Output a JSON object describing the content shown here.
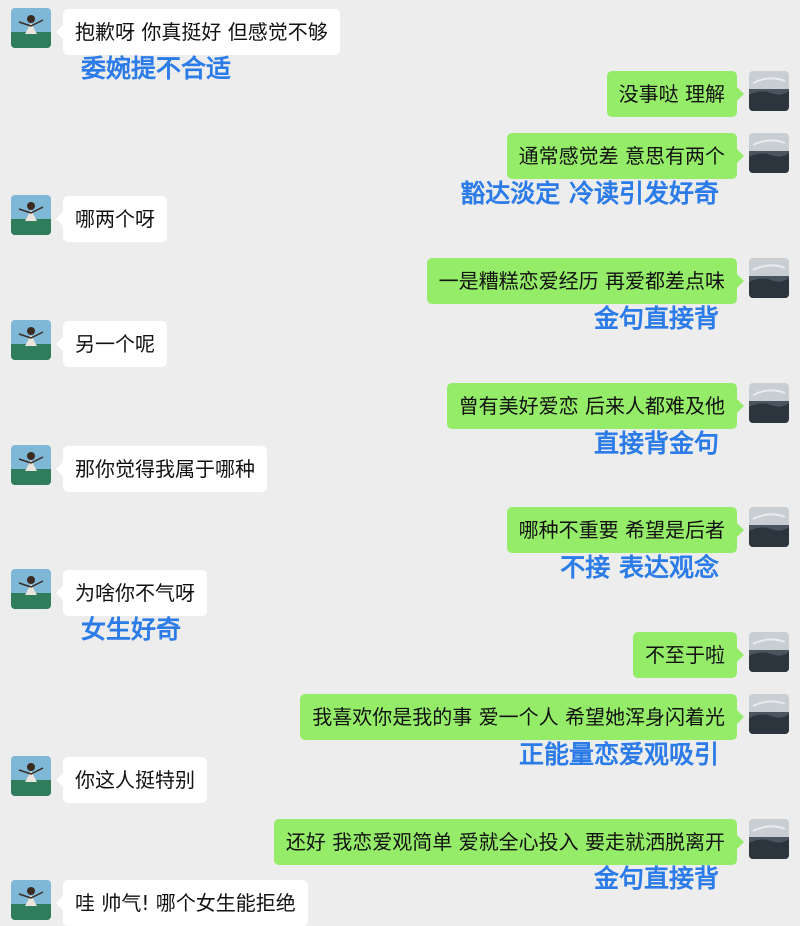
{
  "conversation": {
    "messages": [
      {
        "side": "in",
        "text": "抱歉呀 你真挺好 但感觉不够"
      },
      {
        "side": "out",
        "text": "没事哒 理解"
      },
      {
        "side": "out",
        "text": "通常感觉差 意思有两个"
      },
      {
        "side": "in",
        "text": "哪两个呀"
      },
      {
        "side": "out",
        "text": "一是糟糕恋爱经历 再爱都差点味"
      },
      {
        "side": "in",
        "text": "另一个呢"
      },
      {
        "side": "out",
        "text": "曾有美好爱恋 后来人都难及他"
      },
      {
        "side": "in",
        "text": "那你觉得我属于哪种"
      },
      {
        "side": "out",
        "text": "哪种不重要 希望是后者"
      },
      {
        "side": "in",
        "text": "为啥你不气呀"
      },
      {
        "side": "out",
        "text": "不至于啦"
      },
      {
        "side": "out",
        "text": "我喜欢你是我的事 爱一个人 希望她浑身闪着光"
      },
      {
        "side": "in",
        "text": "你这人挺特别"
      },
      {
        "side": "out",
        "text": "还好 我恋爱观简单 爱就全心投入 要走就洒脱离开"
      },
      {
        "side": "in",
        "text": "哇 帅气! 哪个女生能拒绝"
      }
    ],
    "annotations": [
      {
        "side": "left",
        "text": "委婉提不合适"
      },
      {
        "side": "right",
        "text": "豁达淡定 冷读引发好奇"
      },
      {
        "side": "right",
        "text": "金句直接背"
      },
      {
        "side": "right",
        "text": "直接背金句"
      },
      {
        "side": "right",
        "text": "不接 表达观念"
      },
      {
        "side": "left",
        "text": "女生好奇"
      },
      {
        "side": "right",
        "text": "正能量恋爱观吸引"
      },
      {
        "side": "right",
        "text": "金句直接背"
      }
    ]
  },
  "colors": {
    "background": "#ededed",
    "incoming_bubble": "#ffffff",
    "outgoing_bubble": "#95ec69",
    "annotation_text": "#2b7be8"
  },
  "icons": {
    "incoming_avatar": "person-photo-avatar",
    "outgoing_avatar": "landscape-photo-avatar"
  }
}
